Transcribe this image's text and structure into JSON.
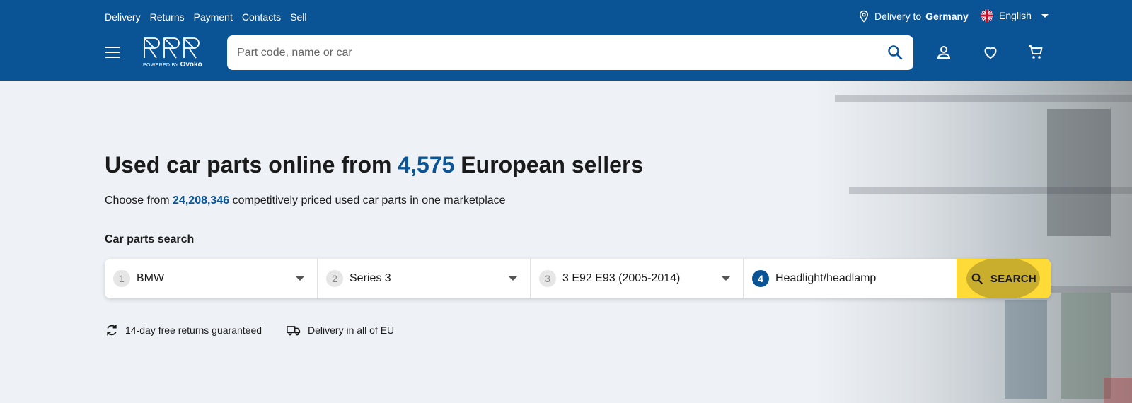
{
  "header": {
    "nav": [
      "Delivery",
      "Returns",
      "Payment",
      "Contacts",
      "Sell"
    ],
    "delivery_prefix": "Delivery to",
    "delivery_country": "Germany",
    "language": "English",
    "logo_text": "RRR",
    "logo_powered": "POWERED BY",
    "logo_brand": "Ovoko",
    "search_placeholder": "Part code, name or car"
  },
  "hero": {
    "title_prefix": "Used car parts online from",
    "seller_count": "4,575",
    "title_suffix": "European sellers",
    "sub_prefix": "Choose from",
    "parts_count": "24,208,346",
    "sub_suffix": "competitively priced used car parts in one marketplace"
  },
  "car_search": {
    "label": "Car parts search",
    "steps": [
      {
        "num": "1",
        "value": "BMW"
      },
      {
        "num": "2",
        "value": "Series 3"
      },
      {
        "num": "3",
        "value": "3 E92 E93 (2005-2014)"
      },
      {
        "num": "4",
        "value": "Headlight/headlamp"
      }
    ],
    "button_label": "SEARCH"
  },
  "perks": {
    "returns": "14-day free returns guaranteed",
    "delivery": "Delivery in all of EU"
  },
  "colors": {
    "brand_blue": "#0a5394",
    "accent_yellow": "#fedb36"
  }
}
